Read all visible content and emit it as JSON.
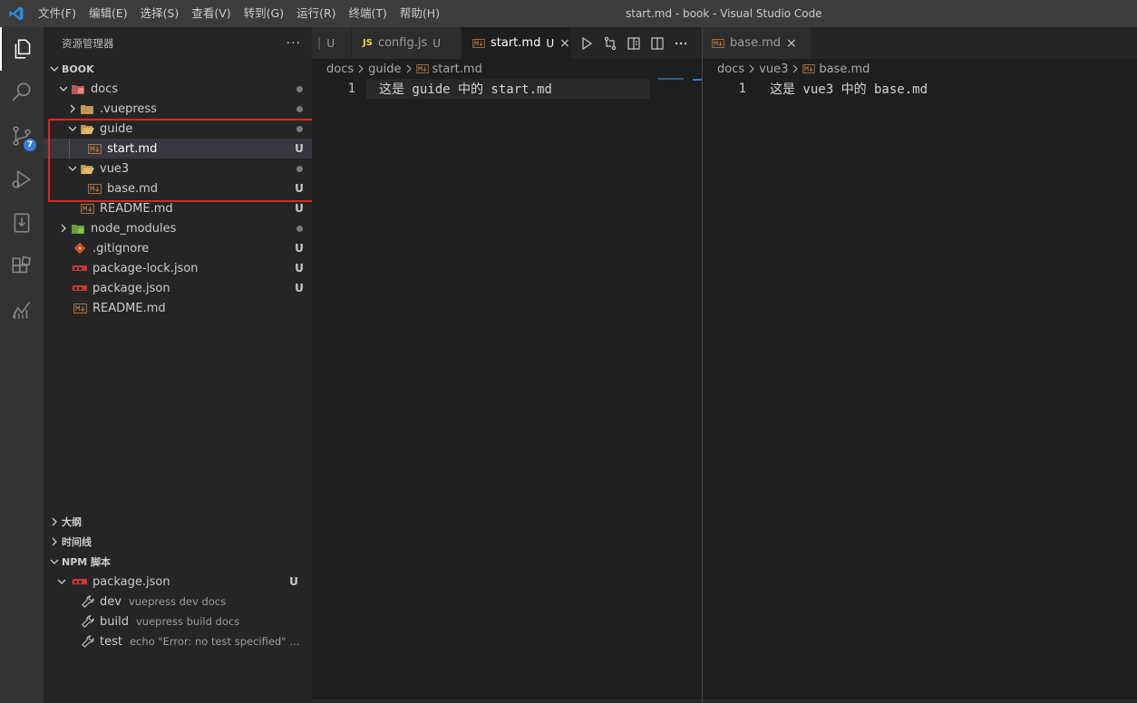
{
  "titlebar": {
    "menus": [
      "文件(F)",
      "编辑(E)",
      "选择(S)",
      "查看(V)",
      "转到(G)",
      "运行(R)",
      "终端(T)",
      "帮助(H)"
    ],
    "window_title": "start.md - book - Visual Studio Code"
  },
  "activity": {
    "icons": [
      "explorer-icon",
      "search-icon",
      "source-control-icon",
      "run-debug-icon",
      "remote-icon",
      "extensions-icon",
      "analytics-icon"
    ],
    "scm_badge": "7"
  },
  "explorer": {
    "title": "资源管理器",
    "more": "···",
    "root": "BOOK",
    "tree": [
      {
        "label": "docs",
        "deco": "•",
        "status": "dot"
      },
      {
        "label": ".vuepress",
        "status": "dot"
      },
      {
        "label": "guide",
        "status": "dot"
      },
      {
        "label": "start.md",
        "status": "U"
      },
      {
        "label": "vue3",
        "status": "dot"
      },
      {
        "label": "base.md",
        "status": "U"
      },
      {
        "label": "README.md",
        "status": "U"
      },
      {
        "label": "node_modules",
        "status": "dot"
      },
      {
        "label": ".gitignore",
        "status": "U"
      },
      {
        "label": "package-lock.json",
        "status": "U"
      },
      {
        "label": "package.json",
        "status": "U"
      },
      {
        "label": "README.md",
        "status": ""
      }
    ]
  },
  "sections": {
    "outline": "大纲",
    "timeline": "时间线",
    "npm": "NPM 脚本"
  },
  "npm": {
    "package": "package.json",
    "package_status": "U",
    "scripts": [
      {
        "name": "dev",
        "cmd": "vuepress dev docs"
      },
      {
        "name": "build",
        "cmd": "vuepress build docs"
      },
      {
        "name": "test",
        "cmd": "echo \"Error: no test specified\" && e..."
      }
    ]
  },
  "left_editor": {
    "tabs": [
      {
        "label": "",
        "status": "U"
      },
      {
        "label": "config.js",
        "status": "U"
      },
      {
        "label": "start.md",
        "status": "U",
        "close": "×"
      }
    ],
    "breadcrumb": [
      "docs",
      "guide",
      "start.md"
    ],
    "lines": [
      {
        "no": "1",
        "text": "这是 guide 中的 start.md"
      }
    ]
  },
  "right_editor": {
    "tabs": [
      {
        "label": "base.md",
        "close": "×"
      }
    ],
    "breadcrumb": [
      "docs",
      "vue3",
      "base.md"
    ],
    "lines": [
      {
        "no": "1",
        "text": "这是 vue3 中的 base.md"
      }
    ]
  },
  "colors": {
    "accent": "#3a7bd5",
    "highlight_box": "#e3261c",
    "js_badge": "#e8d44d",
    "md_icon": "#b07a4f",
    "folder": "#c09553"
  }
}
